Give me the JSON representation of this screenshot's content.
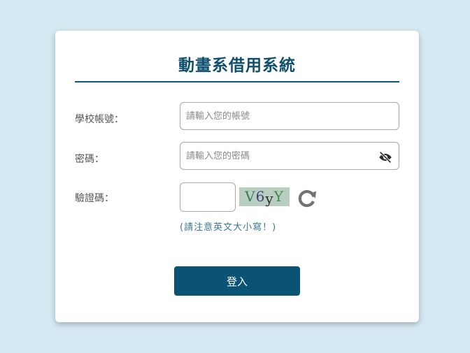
{
  "form": {
    "title": "動畫系借用系統",
    "account_label": "學校帳號：",
    "account_placeholder": "請輸入您的帳號",
    "password_label": "密碼：",
    "password_placeholder": "請輸入您的密碼",
    "captcha_label": "驗證碼：",
    "captcha_value": "",
    "captcha_chars": [
      "V",
      "6",
      "y",
      "Y"
    ],
    "captcha_colors": [
      "#3d7a5a",
      "#4a3d7a",
      "#2a2a2a",
      "#3d8a4a"
    ],
    "case_hint": "(請注意英文大小寫！)",
    "login_label": "登入"
  },
  "icons": {
    "password_toggle": "eye-slash-icon",
    "captcha_refresh": "refresh-icon"
  },
  "colors": {
    "background": "#d4e9f2",
    "accent": "#0b5375",
    "hint": "#3a7893"
  }
}
